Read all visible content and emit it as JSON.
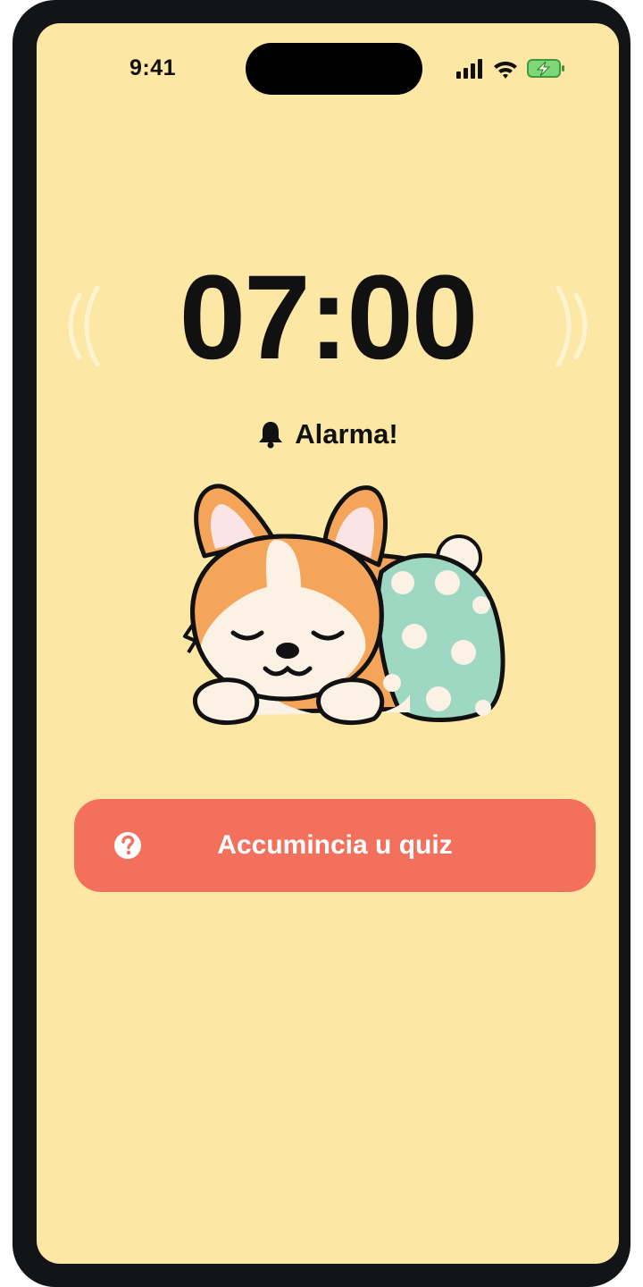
{
  "status_bar": {
    "time": "9:41",
    "icons": [
      "signal-icon",
      "wifi-icon",
      "battery-charging-icon"
    ]
  },
  "alarm": {
    "time": "07:00",
    "label": "Alarma!",
    "label_icon": "bell-icon"
  },
  "illustration": {
    "name": "sleeping-corgi-illustration"
  },
  "quiz_button": {
    "label": "Accumincia u quiz",
    "icon": "question-circle-icon"
  },
  "colors": {
    "background": "#fde7a5",
    "button": "#f3705d",
    "text": "#111111",
    "blanket": "#9fd8c2",
    "fur": "#f5a55a"
  }
}
